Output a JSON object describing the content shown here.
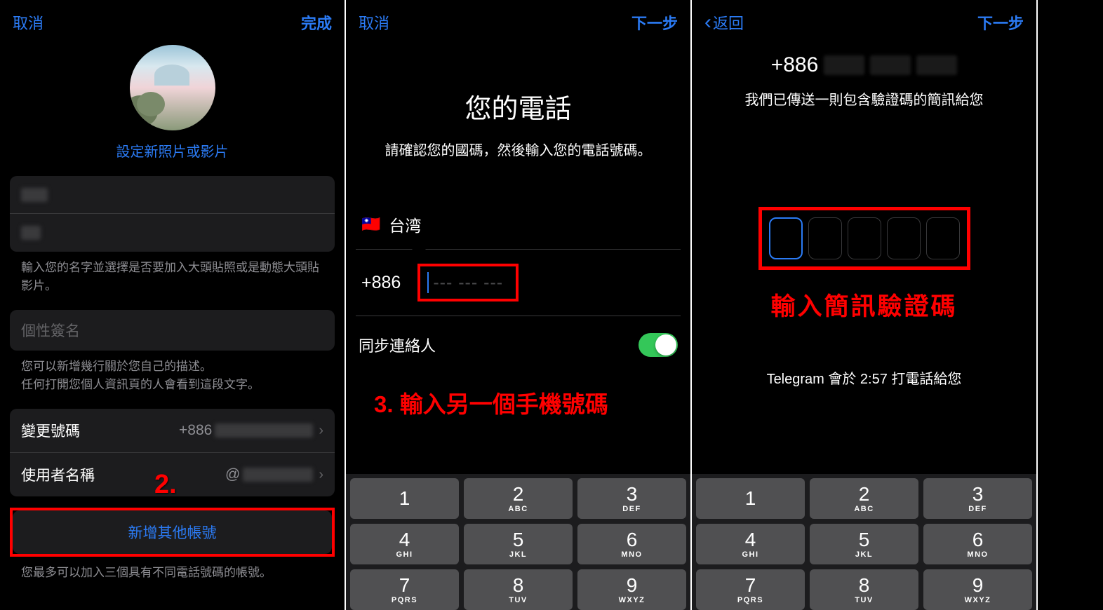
{
  "screen1": {
    "nav": {
      "cancel": "取消",
      "done": "完成"
    },
    "set_photo": "設定新照片或影片",
    "name_help": "輸入您的名字並選擇是否要加入大頭貼照或是動態大頭貼影片。",
    "bio_placeholder": "個性簽名",
    "bio_help1": "您可以新增幾行關於您自己的描述。",
    "bio_help2": "任何打開您個人資訊頁的人會看到這段文字。",
    "change_number": "變更號碼",
    "number_prefix": "+886",
    "username": "使用者名稱",
    "username_prefix": "@",
    "add_account": "新增其他帳號",
    "max_help": "您最多可以加入三個具有不同電話號碼的帳號。",
    "anno": "2."
  },
  "screen2": {
    "nav": {
      "cancel": "取消",
      "next": "下一步"
    },
    "title": "您的電話",
    "subtitle": "請確認您的國碼，然後輸入您的電話號碼。",
    "country": "台湾",
    "code": "+886",
    "placeholder": "--- --- ---",
    "sync": "同步連絡人",
    "anno": "3. 輸入另一個手機號碼"
  },
  "screen3": {
    "nav": {
      "back": "返回",
      "next": "下一步"
    },
    "prefix": "+886",
    "sms_text": "我們已傳送一則包含驗證碼的簡訊給您",
    "code_label": "輸入簡訊驗證碼",
    "callback": "Telegram 會於 2:57 打電話給您"
  },
  "keypad": [
    {
      "n": "1",
      "l": " "
    },
    {
      "n": "2",
      "l": "ABC"
    },
    {
      "n": "3",
      "l": "DEF"
    },
    {
      "n": "4",
      "l": "GHI"
    },
    {
      "n": "5",
      "l": "JKL"
    },
    {
      "n": "6",
      "l": "MNO"
    },
    {
      "n": "7",
      "l": "PQRS"
    },
    {
      "n": "8",
      "l": "TUV"
    },
    {
      "n": "9",
      "l": "WXYZ"
    }
  ]
}
